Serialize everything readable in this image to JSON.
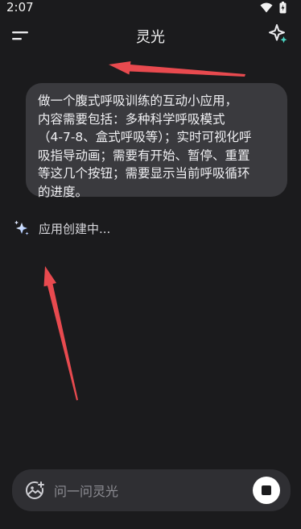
{
  "status_bar": {
    "time": "2:07"
  },
  "header": {
    "title": "灵光"
  },
  "message": {
    "text": "做一个腹式呼吸训练的互动小应用，\n内容需要包括：多种科学呼吸模式\n（4-7-8、盒式呼吸等）；实时可视化呼\n吸指导动画；需要有开始、暂停、重置\n等这几个按钮；需要显示当前呼吸循环\n的进度。"
  },
  "status": {
    "text": "应用创建中..."
  },
  "input": {
    "placeholder": "问一问灵光"
  },
  "colors": {
    "background": "#1b1b1d",
    "bubble": "#3a3a3e",
    "arrow": "#e84a4f",
    "accent": "#4ad6c3"
  }
}
